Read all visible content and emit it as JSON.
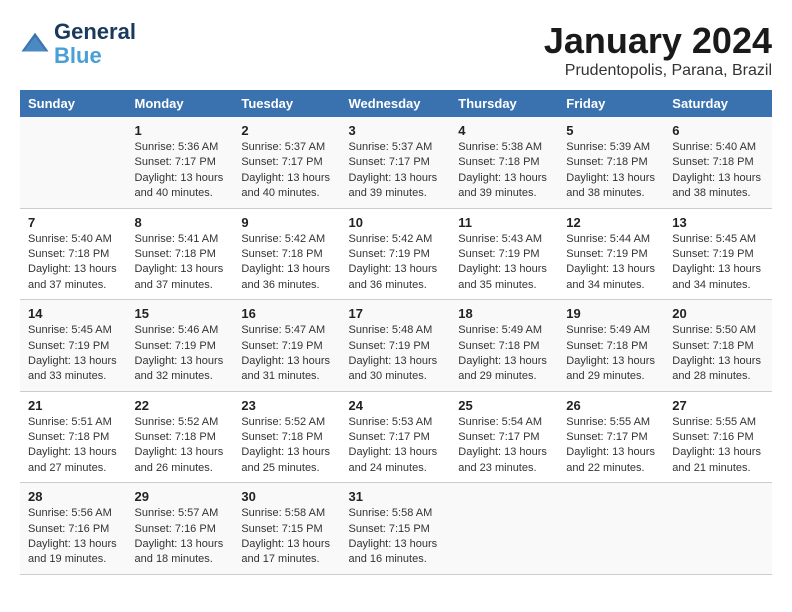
{
  "header": {
    "logo_line1": "General",
    "logo_line2": "Blue",
    "month": "January 2024",
    "location": "Prudentopolis, Parana, Brazil"
  },
  "days_of_week": [
    "Sunday",
    "Monday",
    "Tuesday",
    "Wednesday",
    "Thursday",
    "Friday",
    "Saturday"
  ],
  "weeks": [
    [
      {
        "day": "",
        "info": ""
      },
      {
        "day": "1",
        "info": "Sunrise: 5:36 AM\nSunset: 7:17 PM\nDaylight: 13 hours\nand 40 minutes."
      },
      {
        "day": "2",
        "info": "Sunrise: 5:37 AM\nSunset: 7:17 PM\nDaylight: 13 hours\nand 40 minutes."
      },
      {
        "day": "3",
        "info": "Sunrise: 5:37 AM\nSunset: 7:17 PM\nDaylight: 13 hours\nand 39 minutes."
      },
      {
        "day": "4",
        "info": "Sunrise: 5:38 AM\nSunset: 7:18 PM\nDaylight: 13 hours\nand 39 minutes."
      },
      {
        "day": "5",
        "info": "Sunrise: 5:39 AM\nSunset: 7:18 PM\nDaylight: 13 hours\nand 38 minutes."
      },
      {
        "day": "6",
        "info": "Sunrise: 5:40 AM\nSunset: 7:18 PM\nDaylight: 13 hours\nand 38 minutes."
      }
    ],
    [
      {
        "day": "7",
        "info": "Sunrise: 5:40 AM\nSunset: 7:18 PM\nDaylight: 13 hours\nand 37 minutes."
      },
      {
        "day": "8",
        "info": "Sunrise: 5:41 AM\nSunset: 7:18 PM\nDaylight: 13 hours\nand 37 minutes."
      },
      {
        "day": "9",
        "info": "Sunrise: 5:42 AM\nSunset: 7:18 PM\nDaylight: 13 hours\nand 36 minutes."
      },
      {
        "day": "10",
        "info": "Sunrise: 5:42 AM\nSunset: 7:19 PM\nDaylight: 13 hours\nand 36 minutes."
      },
      {
        "day": "11",
        "info": "Sunrise: 5:43 AM\nSunset: 7:19 PM\nDaylight: 13 hours\nand 35 minutes."
      },
      {
        "day": "12",
        "info": "Sunrise: 5:44 AM\nSunset: 7:19 PM\nDaylight: 13 hours\nand 34 minutes."
      },
      {
        "day": "13",
        "info": "Sunrise: 5:45 AM\nSunset: 7:19 PM\nDaylight: 13 hours\nand 34 minutes."
      }
    ],
    [
      {
        "day": "14",
        "info": "Sunrise: 5:45 AM\nSunset: 7:19 PM\nDaylight: 13 hours\nand 33 minutes."
      },
      {
        "day": "15",
        "info": "Sunrise: 5:46 AM\nSunset: 7:19 PM\nDaylight: 13 hours\nand 32 minutes."
      },
      {
        "day": "16",
        "info": "Sunrise: 5:47 AM\nSunset: 7:19 PM\nDaylight: 13 hours\nand 31 minutes."
      },
      {
        "day": "17",
        "info": "Sunrise: 5:48 AM\nSunset: 7:19 PM\nDaylight: 13 hours\nand 30 minutes."
      },
      {
        "day": "18",
        "info": "Sunrise: 5:49 AM\nSunset: 7:18 PM\nDaylight: 13 hours\nand 29 minutes."
      },
      {
        "day": "19",
        "info": "Sunrise: 5:49 AM\nSunset: 7:18 PM\nDaylight: 13 hours\nand 29 minutes."
      },
      {
        "day": "20",
        "info": "Sunrise: 5:50 AM\nSunset: 7:18 PM\nDaylight: 13 hours\nand 28 minutes."
      }
    ],
    [
      {
        "day": "21",
        "info": "Sunrise: 5:51 AM\nSunset: 7:18 PM\nDaylight: 13 hours\nand 27 minutes."
      },
      {
        "day": "22",
        "info": "Sunrise: 5:52 AM\nSunset: 7:18 PM\nDaylight: 13 hours\nand 26 minutes."
      },
      {
        "day": "23",
        "info": "Sunrise: 5:52 AM\nSunset: 7:18 PM\nDaylight: 13 hours\nand 25 minutes."
      },
      {
        "day": "24",
        "info": "Sunrise: 5:53 AM\nSunset: 7:17 PM\nDaylight: 13 hours\nand 24 minutes."
      },
      {
        "day": "25",
        "info": "Sunrise: 5:54 AM\nSunset: 7:17 PM\nDaylight: 13 hours\nand 23 minutes."
      },
      {
        "day": "26",
        "info": "Sunrise: 5:55 AM\nSunset: 7:17 PM\nDaylight: 13 hours\nand 22 minutes."
      },
      {
        "day": "27",
        "info": "Sunrise: 5:55 AM\nSunset: 7:16 PM\nDaylight: 13 hours\nand 21 minutes."
      }
    ],
    [
      {
        "day": "28",
        "info": "Sunrise: 5:56 AM\nSunset: 7:16 PM\nDaylight: 13 hours\nand 19 minutes."
      },
      {
        "day": "29",
        "info": "Sunrise: 5:57 AM\nSunset: 7:16 PM\nDaylight: 13 hours\nand 18 minutes."
      },
      {
        "day": "30",
        "info": "Sunrise: 5:58 AM\nSunset: 7:15 PM\nDaylight: 13 hours\nand 17 minutes."
      },
      {
        "day": "31",
        "info": "Sunrise: 5:58 AM\nSunset: 7:15 PM\nDaylight: 13 hours\nand 16 minutes."
      },
      {
        "day": "",
        "info": ""
      },
      {
        "day": "",
        "info": ""
      },
      {
        "day": "",
        "info": ""
      }
    ]
  ]
}
